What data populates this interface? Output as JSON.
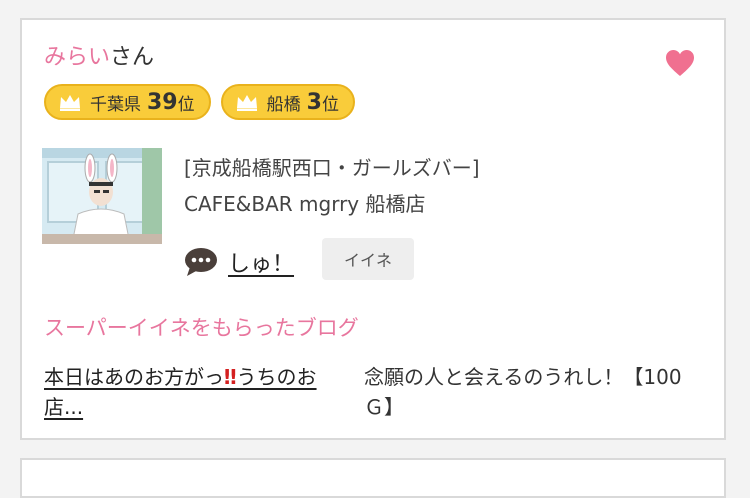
{
  "user": {
    "name": "みらい",
    "suffix": "さん"
  },
  "badges": [
    {
      "area": "千葉県",
      "rank": "39",
      "unit": "位"
    },
    {
      "area": "船橋",
      "rank": "3",
      "unit": "位"
    }
  ],
  "shop": {
    "category": "[京成船橋駅西口・ガールズバー]",
    "name": "CAFE&BAR mgrry 船橋店"
  },
  "comment": {
    "text": "しゅ！"
  },
  "iine_button": {
    "label": "イイネ"
  },
  "blog_section": {
    "title": "スーパーイイネをもらったブログ"
  },
  "blog": {
    "title_before": "本日はあのお方がっ",
    "title_emphasis": "‼",
    "title_after": "うちのお店...",
    "excerpt": "念願の人と会えるのうれし！【100Ｇ】"
  },
  "icons": {
    "heart": "heart-icon",
    "crown": "crown-icon",
    "comment": "speech-bubble-icon"
  },
  "colors": {
    "accent_pink": "#e8769e",
    "badge_gold": "#f9cc3a",
    "heart": "#f07090",
    "bubble": "#4a3f3a"
  }
}
